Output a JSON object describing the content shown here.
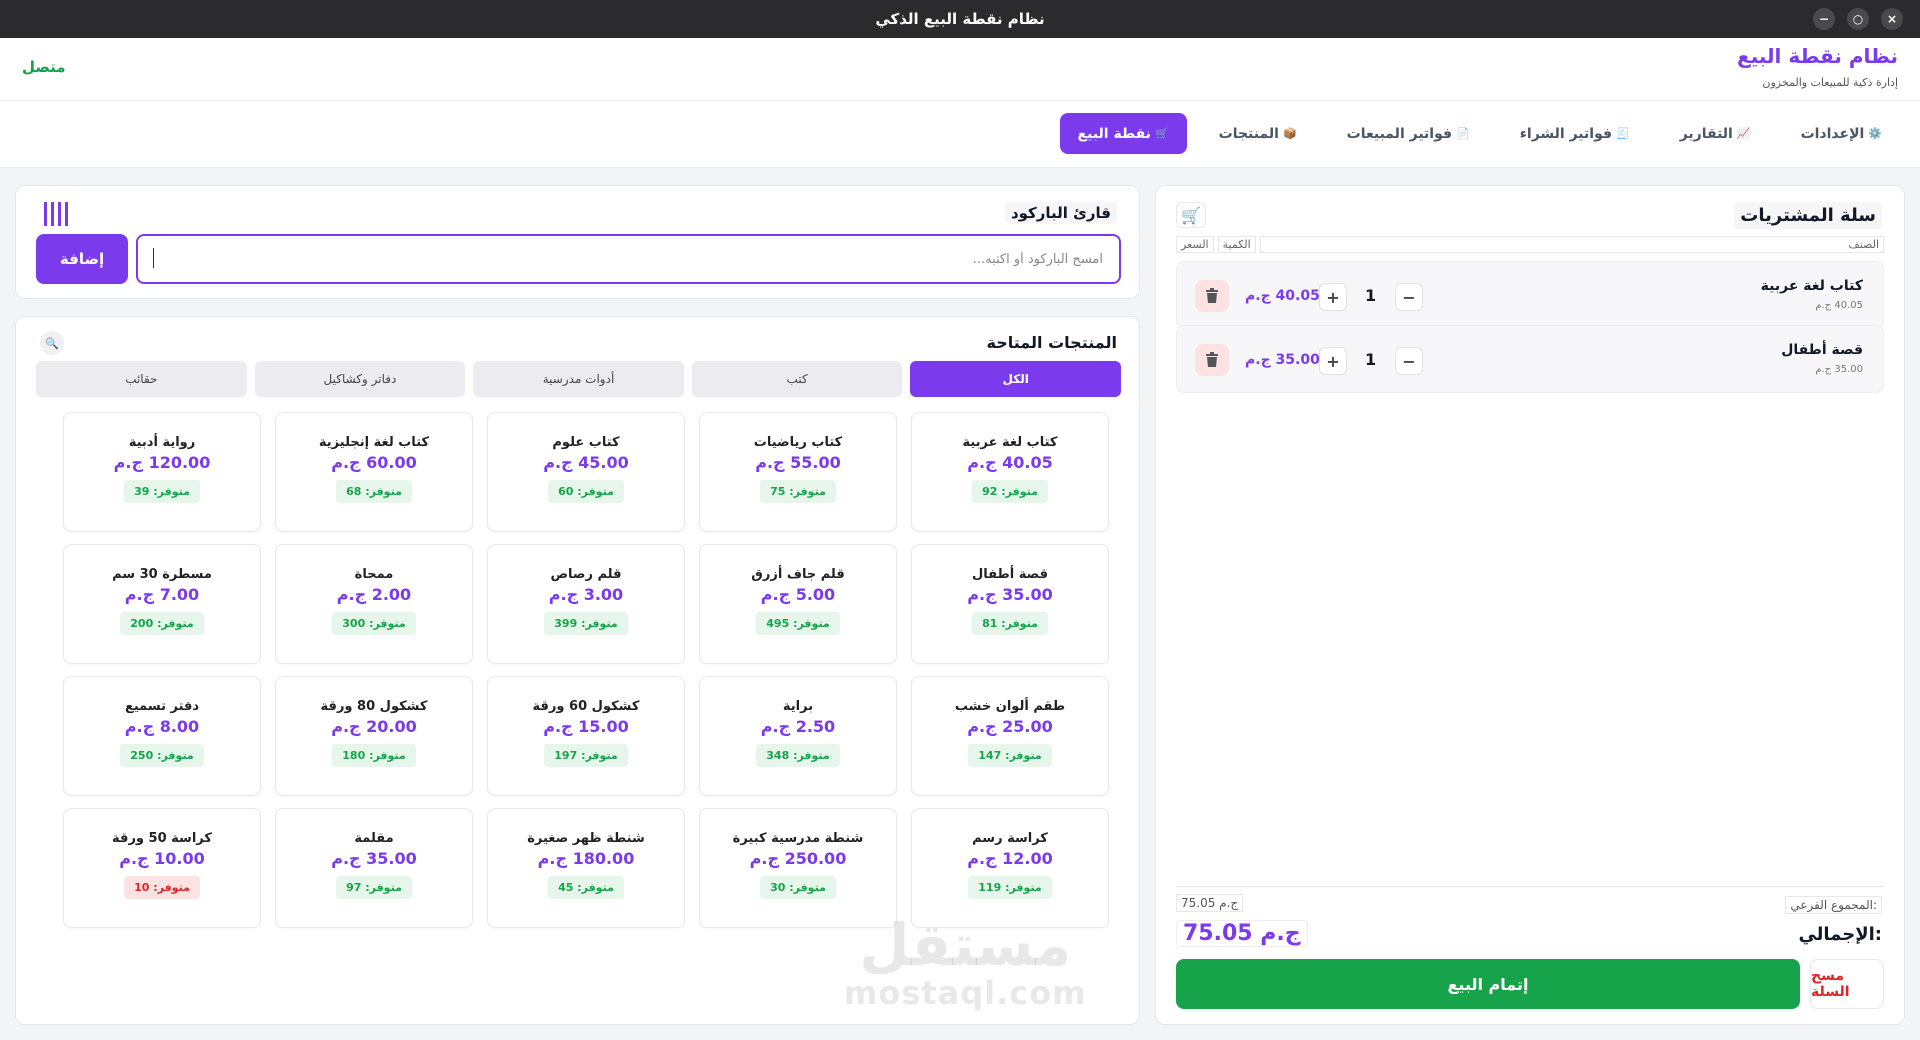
{
  "window": {
    "title": "نظام نقطة البيع الذكي",
    "controls": [
      "−",
      "○",
      "×"
    ]
  },
  "header": {
    "status": "متصل",
    "brand_title": "نظام نقطة البيع",
    "brand_subtitle": "إدارة ذكية للمبيعات والمخزون"
  },
  "nav": {
    "tabs": [
      {
        "icon": "🛒",
        "label": "نقطة البيع",
        "active": true
      },
      {
        "icon": "📦",
        "label": "المنتجات",
        "active": false
      },
      {
        "icon": "📄",
        "label": "فواتير المبيعات",
        "active": false
      },
      {
        "icon": "🧾",
        "label": "فواتير الشراء",
        "active": false
      },
      {
        "icon": "📈",
        "label": "التقارير",
        "active": false
      },
      {
        "icon": "⚙️",
        "label": "الإعدادات",
        "active": false
      }
    ]
  },
  "cart": {
    "title": "سلة المشتريات",
    "icon": "🛒",
    "headers": {
      "item": "الصنف",
      "qty": "الكمية",
      "price": "السعر"
    },
    "items": [
      {
        "name": "كتاب لغة عربية",
        "unit_price": "40.05 ج.م",
        "qty": "1",
        "total": "40.05 ج.م"
      },
      {
        "name": "قصة أطفال",
        "unit_price": "35.00 ج.م",
        "qty": "1",
        "total": "35.00 ج.م"
      }
    ],
    "minus": "−",
    "plus": "+",
    "subtotal_label": "المجموع الفرعي:",
    "subtotal_value": "75.05 ج.م",
    "total_label": "الإجمالي:",
    "total_value": "75.05 ج.م",
    "checkout_label": "إتمام البيع",
    "clear_label": "مسح السلة"
  },
  "barcode": {
    "title": "قارئ الباركود",
    "placeholder": "امسح الباركود أو اكتبه...",
    "add_label": "إضافة"
  },
  "products": {
    "title": "المنتجات المتاحة",
    "search_icon": "🔍",
    "categories": [
      {
        "label": "الكل",
        "active": true
      },
      {
        "label": "كتب",
        "active": false
      },
      {
        "label": "أدوات مدرسية",
        "active": false
      },
      {
        "label": "دفاتر وكشاكيل",
        "active": false
      },
      {
        "label": "حقائب",
        "active": false
      }
    ],
    "items": [
      {
        "name": "كتاب لغة عربية",
        "price": "40.05 ج.م",
        "stock": "متوفر: 92",
        "low": false
      },
      {
        "name": "كتاب رياضيات",
        "price": "55.00 ج.م",
        "stock": "متوفر: 75",
        "low": false
      },
      {
        "name": "كتاب علوم",
        "price": "45.00 ج.م",
        "stock": "متوفر: 60",
        "low": false
      },
      {
        "name": "كتاب لغة إنجليزية",
        "price": "60.00 ج.م",
        "stock": "متوفر: 68",
        "low": false
      },
      {
        "name": "رواية أدبية",
        "price": "120.00 ج.م",
        "stock": "متوفر: 39",
        "low": false
      },
      {
        "name": "قصة أطفال",
        "price": "35.00 ج.م",
        "stock": "متوفر: 81",
        "low": false
      },
      {
        "name": "قلم جاف أزرق",
        "price": "5.00 ج.م",
        "stock": "متوفر: 495",
        "low": false
      },
      {
        "name": "قلم رصاص",
        "price": "3.00 ج.م",
        "stock": "متوفر: 399",
        "low": false
      },
      {
        "name": "ممحاة",
        "price": "2.00 ج.م",
        "stock": "متوفر: 300",
        "low": false
      },
      {
        "name": "مسطرة 30 سم",
        "price": "7.00 ج.م",
        "stock": "متوفر: 200",
        "low": false
      },
      {
        "name": "طقم ألوان خشب",
        "price": "25.00 ج.م",
        "stock": "متوفر: 147",
        "low": false
      },
      {
        "name": "براية",
        "price": "2.50 ج.م",
        "stock": "متوفر: 348",
        "low": false
      },
      {
        "name": "كشكول 60 ورقة",
        "price": "15.00 ج.م",
        "stock": "متوفر: 197",
        "low": false
      },
      {
        "name": "كشكول 80 ورقة",
        "price": "20.00 ج.م",
        "stock": "متوفر: 180",
        "low": false
      },
      {
        "name": "دفتر تسميع",
        "price": "8.00 ج.م",
        "stock": "متوفر: 250",
        "low": false
      },
      {
        "name": "كراسة رسم",
        "price": "12.00 ج.م",
        "stock": "متوفر: 119",
        "low": false
      },
      {
        "name": "شنطة مدرسية كبيرة",
        "price": "250.00 ج.م",
        "stock": "متوفر: 30",
        "low": false
      },
      {
        "name": "شنطة ظهر صغيرة",
        "price": "180.00 ج.م",
        "stock": "متوفر: 45",
        "low": false
      },
      {
        "name": "مقلمة",
        "price": "35.00 ج.م",
        "stock": "متوفر: 97",
        "low": false
      },
      {
        "name": "كراسة 50 ورقة",
        "price": "10.00 ج.م",
        "stock": "متوفر: 10",
        "low": true
      }
    ]
  },
  "watermark": {
    "arabic": "مستقل",
    "latin": "mostaql.com"
  }
}
